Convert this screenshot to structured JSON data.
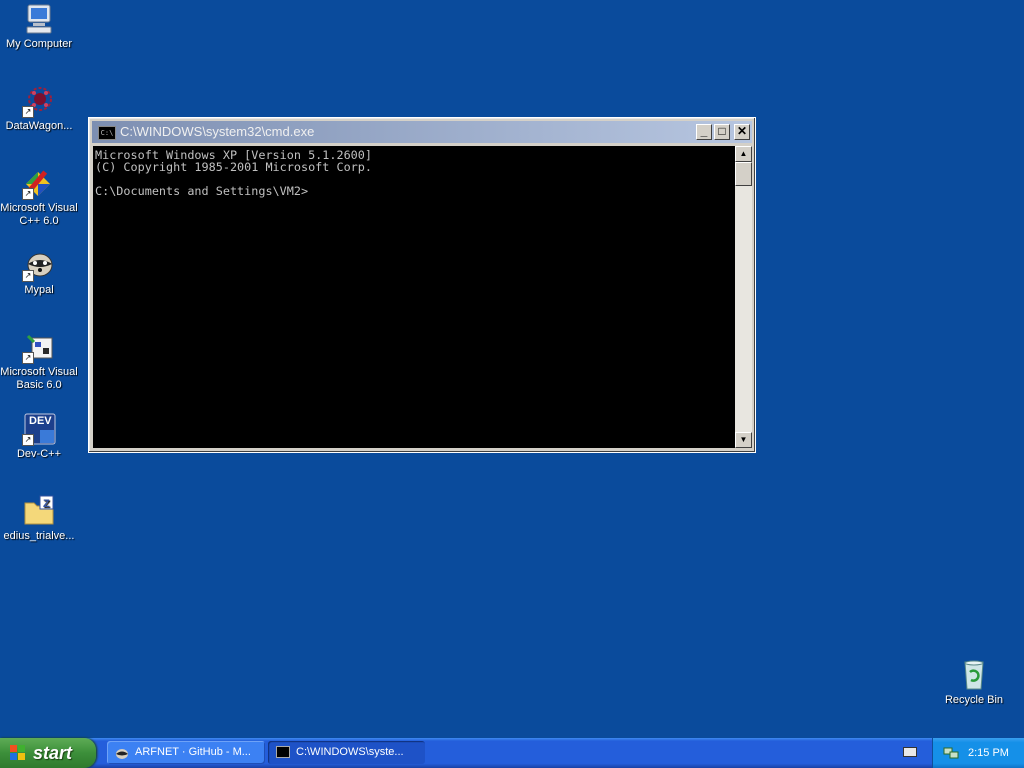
{
  "desktop": {
    "icons": [
      {
        "label": "My Computer",
        "icon": "my-computer-icon"
      },
      {
        "label": "DataWagon...",
        "icon": "datawagon-icon"
      },
      {
        "label": "Microsoft Visual C++ 6.0",
        "icon": "visual-cpp-icon"
      },
      {
        "label": "Mypal",
        "icon": "mypal-icon"
      },
      {
        "label": "Microsoft Visual Basic 6.0",
        "icon": "visual-basic-icon"
      },
      {
        "label": "Dev-C++",
        "icon": "dev-cpp-icon"
      },
      {
        "label": "edius_trialve...",
        "icon": "zip-folder-icon"
      },
      {
        "label": "Recycle Bin",
        "icon": "recycle-bin-icon"
      }
    ],
    "dev_icon_text": "DEV"
  },
  "cmd": {
    "title": "C:\\WINDOWS\\system32\\cmd.exe",
    "title_icon_text": "C:\\",
    "lines": [
      "Microsoft Windows XP [Version 5.1.2600]",
      "(C) Copyright 1985-2001 Microsoft Corp.",
      "",
      "C:\\Documents and Settings\\VM2>"
    ],
    "buttons": {
      "minimize": "_",
      "maximize": "□",
      "close": "✕"
    }
  },
  "taskbar": {
    "start_label": "start",
    "tasks": [
      {
        "label": "ARFNET · GitHub - M...",
        "icon": "browser-icon",
        "active": false
      },
      {
        "label": "C:\\WINDOWS\\syste...",
        "icon": "cmd-icon",
        "active": true
      }
    ],
    "clock": "2:15 PM",
    "colors": {
      "taskbar": "#245edb",
      "start": "#3c8f3a",
      "tray": "#1590e8",
      "desktop": "#0a4b9c"
    }
  }
}
